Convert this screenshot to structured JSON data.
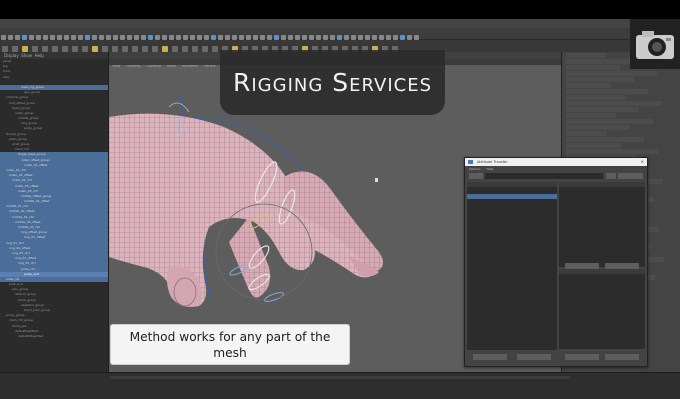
{
  "title_card": {
    "text": "Rigging Services"
  },
  "caption": {
    "text": "Method works for any part of the mesh"
  },
  "menubar": [
    "File",
    "Edit",
    "Create",
    "Select",
    "Modify",
    "Display",
    "Windows",
    "Mesh",
    "Edit Mesh",
    "Mesh Tools",
    "Mesh Display",
    "Curves",
    "Surfaces",
    "Deform",
    "UV",
    "Generate",
    "Cache",
    "Help"
  ],
  "viewport_menu": [
    "View",
    "Shading",
    "Lighting",
    "Show",
    "Renderer",
    "Panels"
  ],
  "dialog": {
    "title": "Attribute Transfer",
    "menus": [
      "Options",
      "Help"
    ]
  },
  "outliner": {
    "rows": [
      {
        "label": "persp",
        "sel": false
      },
      {
        "label": "top",
        "sel": false
      },
      {
        "label": "front",
        "sel": false
      },
      {
        "label": "side",
        "sel": false
      },
      {
        "label": "",
        "sel": false
      },
      {
        "label": "main_rig_group",
        "sel": true
      },
      {
        "label": "geo_group",
        "sel": false
      },
      {
        "label": "controls_group",
        "sel": false
      },
      {
        "label": "root_offset_group",
        "sel": false
      },
      {
        "label": "hand_group",
        "sel": false
      },
      {
        "label": "index_group",
        "sel": false
      },
      {
        "label": "middle_group",
        "sel": false
      },
      {
        "label": "ring_group",
        "sel": false
      },
      {
        "label": "pinky_group",
        "sel": false
      },
      {
        "label": "thumb_group",
        "sel": false
      },
      {
        "label": "palm_group",
        "sel": false
      },
      {
        "label": "wrist_group",
        "sel": false
      },
      {
        "label": "hand_ctrl",
        "sel": false
      },
      {
        "label": "finger_base_group",
        "sel": true
      },
      {
        "label": "index_offset_group",
        "sel": true
      },
      {
        "label": "index_01_offset",
        "sel": true
      },
      {
        "label": "index_01_ctrl",
        "sel": true
      },
      {
        "label": "index_02_offset",
        "sel": true
      },
      {
        "label": "index_02_ctrl",
        "sel": true
      },
      {
        "label": "index_03_offset",
        "sel": true
      },
      {
        "label": "index_03_ctrl",
        "sel": true
      },
      {
        "label": "middle_offset_group",
        "sel": true
      },
      {
        "label": "middle_01_offset",
        "sel": true
      },
      {
        "label": "middle_01_ctrl",
        "sel": true
      },
      {
        "label": "middle_02_offset",
        "sel": true
      },
      {
        "label": "middle_02_ctrl",
        "sel": true
      },
      {
        "label": "middle_03_offset",
        "sel": true
      },
      {
        "label": "middle_03_ctrl",
        "sel": true
      },
      {
        "label": "ring_offset_group",
        "sel": true
      },
      {
        "label": "ring_01_offset",
        "sel": true
      },
      {
        "label": "ring_01_ctrl",
        "sel": true
      },
      {
        "label": "ring_02_offset",
        "sel": true
      },
      {
        "label": "ring_02_ctrl",
        "sel": true
      },
      {
        "label": "ring_03_offset",
        "sel": true
      },
      {
        "label": "ring_03_ctrl",
        "sel": true
      },
      {
        "label": "pinky_ctrl",
        "sel": true
      },
      {
        "label": "pinky_end",
        "sel": true
      },
      {
        "label": "pinky_tip",
        "sel": true
      },
      {
        "label": "joint_end",
        "sel": false
      },
      {
        "label": "skin_group",
        "sel": false
      },
      {
        "label": "deform_group",
        "sel": false
      },
      {
        "label": "extra_group",
        "sel": false
      },
      {
        "label": "skeleton_group",
        "sel": false
      },
      {
        "label": "hand_joint_group",
        "sel": false
      },
      {
        "label": "proxy_group",
        "sel": false
      },
      {
        "label": "main_ctrl_group",
        "sel": false
      },
      {
        "label": "hand_geo",
        "sel": false
      },
      {
        "label": "defaultLightSet",
        "sel": false
      },
      {
        "label": "defaultObjectSet",
        "sel": false
      }
    ]
  }
}
